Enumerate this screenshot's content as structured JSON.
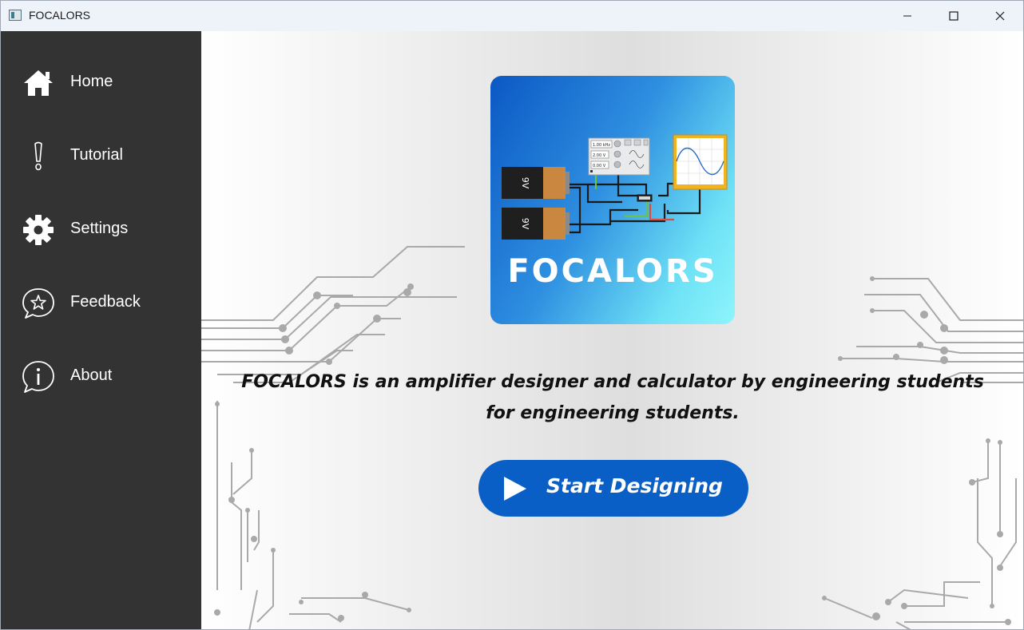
{
  "window": {
    "title": "FOCALORS"
  },
  "sidebar": {
    "items": [
      {
        "label": "Home",
        "icon": "home-icon"
      },
      {
        "label": "Tutorial",
        "icon": "exclamation-icon"
      },
      {
        "label": "Settings",
        "icon": "gear-icon"
      },
      {
        "label": "Feedback",
        "icon": "feedback-star-icon"
      },
      {
        "label": "About",
        "icon": "info-icon"
      }
    ]
  },
  "main": {
    "logo": {
      "text": "FOCALORS",
      "battery_label": "9V",
      "instrument_readouts": [
        "1.00 kHz",
        "2.00 V",
        "0.00 V"
      ]
    },
    "description": "FOCALORS is an amplifier designer and calculator by engineering students for engineering students.",
    "start_button": {
      "label": "Start Designing",
      "icon": "play-icon"
    }
  },
  "colors": {
    "sidebar_bg": "#333333",
    "accent": "#0a5fc7",
    "titlebar_bg": "#eef2f9"
  }
}
